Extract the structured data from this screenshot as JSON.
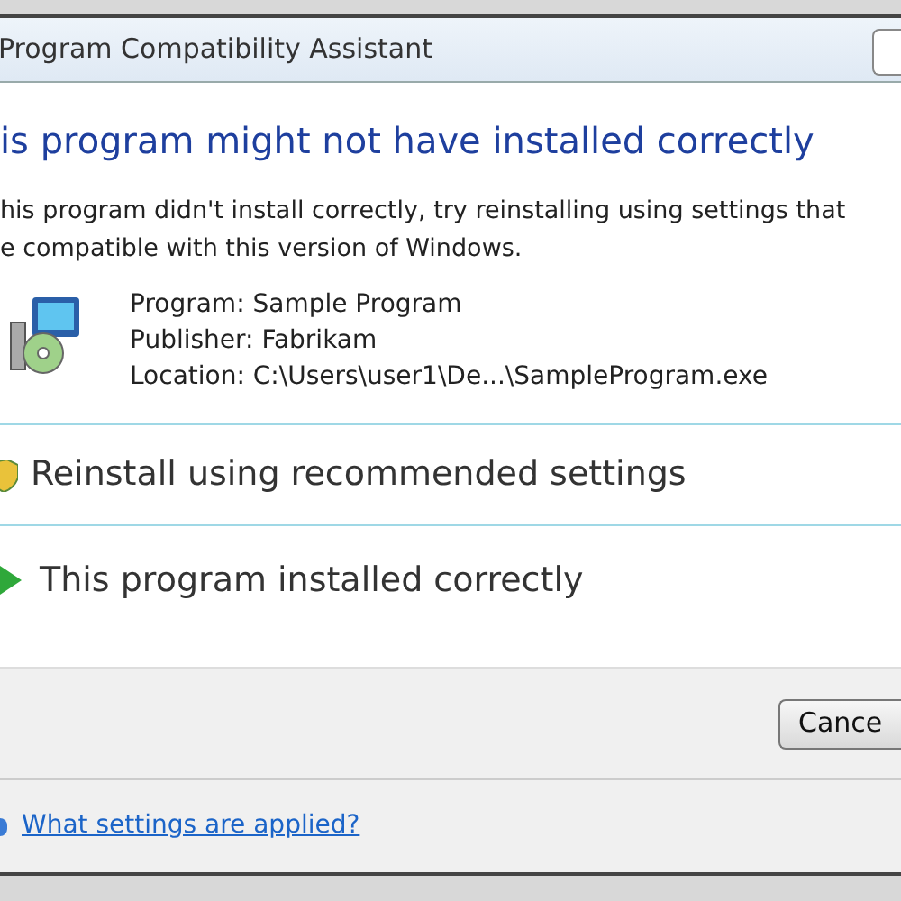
{
  "window": {
    "title": "Program Compatibility Assistant"
  },
  "heading": "is program might not have installed correctly",
  "description": [
    "his program didn't install correctly, try reinstalling using settings that",
    "e compatible with this version of Windows."
  ],
  "details": [
    "Program: Sample Program",
    "Publisher: Fabrikam",
    "Location: C:\\Users\\user1\\De...\\SampleProgram.exe"
  ],
  "options": [
    {
      "kind": "shield",
      "label": "Reinstall using recommended settings"
    },
    {
      "kind": "arrow",
      "label": "This program installed correctly"
    }
  ],
  "buttons": [
    "Cance"
  ],
  "link": "What settings are applied?"
}
